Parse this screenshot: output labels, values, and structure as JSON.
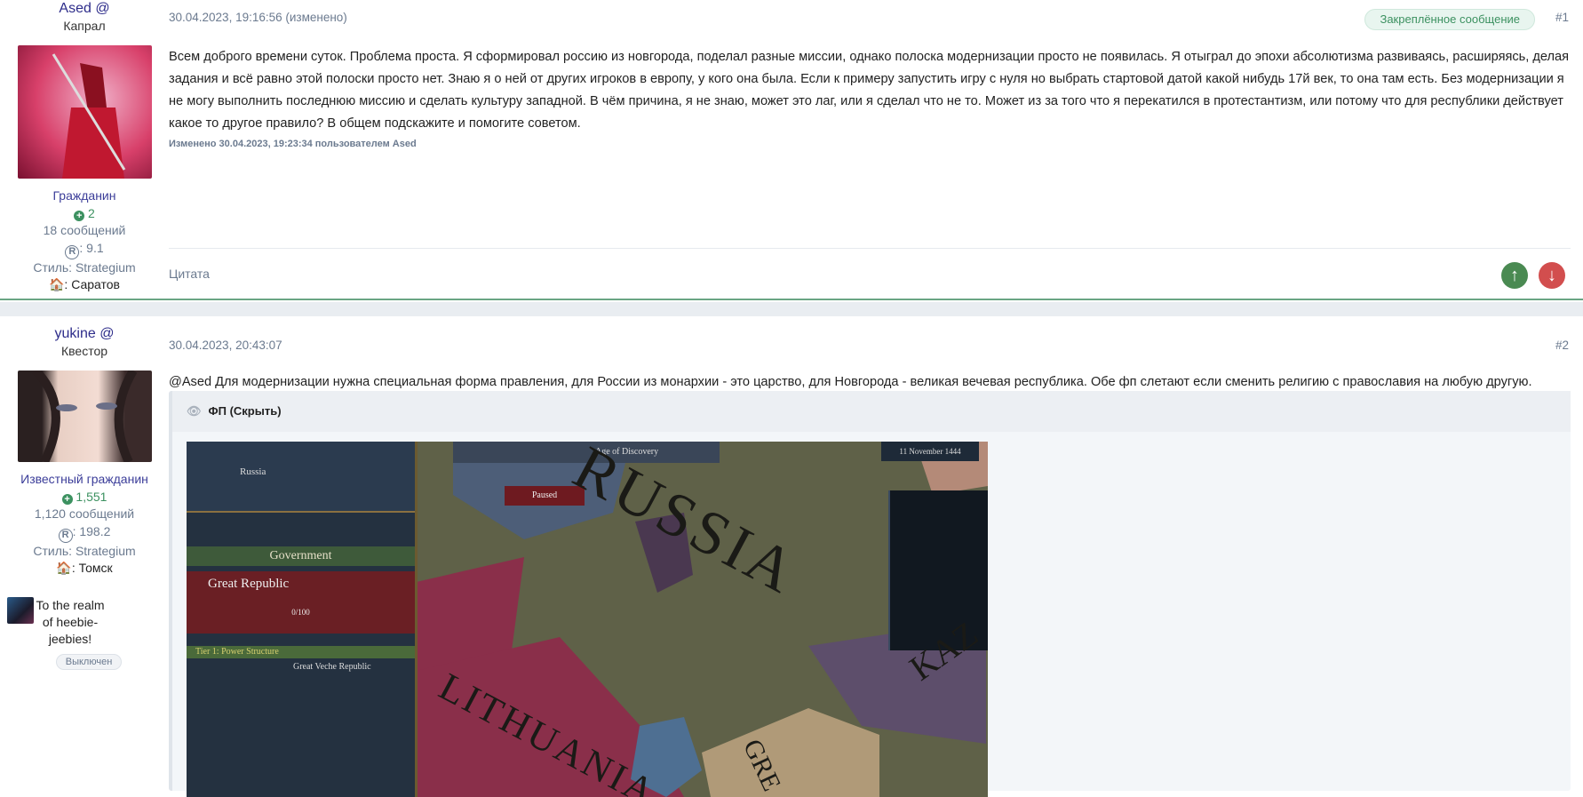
{
  "posts": [
    {
      "author": "Ased @",
      "rank": "Капрал",
      "title": "Гражданин",
      "reputation": "2",
      "messages": "18 сообщений",
      "rating_label": "R",
      "rating": ": 9.1",
      "style": "Стиль: Strategium",
      "city": ": Саратов",
      "date": "30.04.2023, 19:16:56 (изменено)",
      "pinned": "Закреплённое сообщение",
      "number": "#1",
      "text": "Всем доброго времени суток. Проблема проста. Я сформировал россию из новгорода, поделал разные миссии, однако полоска модернизации просто не появилась. Я отыграл до эпохи абсолютизма развиваясь, расширяясь, делая задания и всё равно этой полоски просто нет. Знаю я о ней от других игроков в европу, у кого она была. Если к примеру запустить игру с нуля но выбрать стартовой датой какой нибудь 17й век, то она там есть. Без модернизации я не могу выполнить последнюю миссию и сделать культуру западной. В чём причина, я не знаю, может это лаг, или я сделал что не то. Может из за того что я перекатился в протестантизм, или потому что для республики действует какое то другое правило? В общем подскажите и помогите советом.",
      "edited": "Изменено 30.04.2023, 19:23:34 пользователем Ased",
      "quote": "Цитата"
    },
    {
      "author": "yukine @",
      "rank": "Квестор",
      "title": "Известный гражданин",
      "reputation": "1,551",
      "messages": "1,120 сообщений",
      "rating_label": "R",
      "rating": ": 198.2",
      "style": "Стиль: Strategium",
      "city": ": Томск",
      "club": "To the realm of heebie-jeebies!",
      "club_status": "Выключен",
      "date": "30.04.2023, 20:43:07",
      "number": "#2",
      "text": "@Ased Для модернизации нужна специальная форма правления, для России из монархии - это царство, для Новгорода - великая вечевая республика. Обе фп слетают если сменить религию с православия на любую другую.",
      "spoiler": "ФП (Скрыть)"
    }
  ],
  "game": {
    "country": "Russia",
    "age": "Age of Discovery",
    "date": "11 November 1444",
    "paused": "Paused",
    "panel": "Government",
    "gov": "Great Republic",
    "tier1": "Tier 1: Power Structure",
    "reform": "Great Veche Republic",
    "progress": "0/100",
    "map_labels": [
      "RUSSIA",
      "LITHUANIA",
      "KAZ",
      "GRE"
    ]
  },
  "colors": {
    "upvote": "#4a8a52",
    "downvote": "#d24e4e",
    "accent": "#3c9160"
  }
}
